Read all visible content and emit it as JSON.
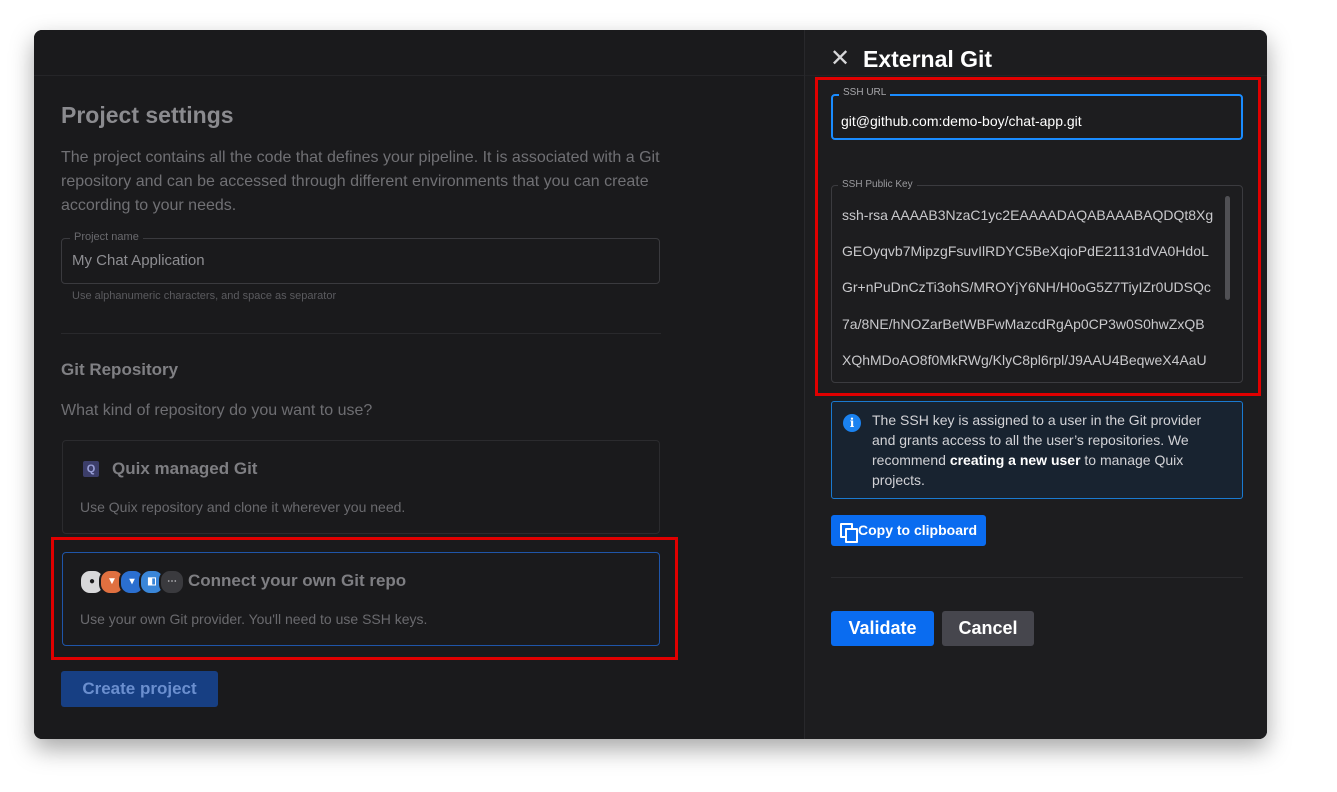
{
  "project_settings": {
    "title": "Project settings",
    "description": "The project contains all the code that defines your pipeline. It is associated with a Git repository and can be accessed through different environments that you can create according to your needs.",
    "project_name_label": "Project name",
    "project_name_value": "My Chat Application",
    "project_name_hint": "Use alphanumeric characters, and space as separator"
  },
  "git_repository": {
    "title": "Git Repository",
    "question": "What kind of repository do you want to use?",
    "options": [
      {
        "title": "Quix managed Git",
        "description": "Use Quix repository and clone it wherever you need."
      },
      {
        "title": "Connect your own Git repo",
        "description": "Use your own Git provider. You'll need to use SSH keys."
      }
    ],
    "create_button": "Create project"
  },
  "external_git": {
    "title": "External Git",
    "ssh_url_label": "SSH URL",
    "ssh_url_value": "git@github.com:demo-boy/chat-app.git",
    "ssh_key_label": "SSH Public Key",
    "ssh_key_lines": [
      "ssh-rsa AAAAB3NzaC1yc2EAAAADAQABAAABAQDQt8Xg",
      "GEOyqvb7MipzgFsuvIlRDYC5BeXqioPdE21131dVA0HdoL",
      "Gr+nPuDnCzTi3ohS/MROYjY6NH/H0oG5Z7TiyIZr0UDSQc",
      "7a/8NE/hNOZarBetWBFwMazcdRgAp0CP3w0S0hwZxQB",
      "XQhMDoAO8f0MkRWg/KlyC8pl6rpl/J9AAU4BeqweX4AaU"
    ],
    "info_text_1": "The SSH key is assigned to a user in the Git provider and grants access to all the user’s repositories. We recommend ",
    "info_link": "creating a new user",
    "info_text_2": " to manage Quix projects.",
    "copy_button": "Copy to clipboard",
    "validate_button": "Validate",
    "cancel_button": "Cancel"
  },
  "colors": {
    "accent": "#0a6cf0",
    "highlight_border": "#e00000",
    "background": "#1b1b1d"
  }
}
